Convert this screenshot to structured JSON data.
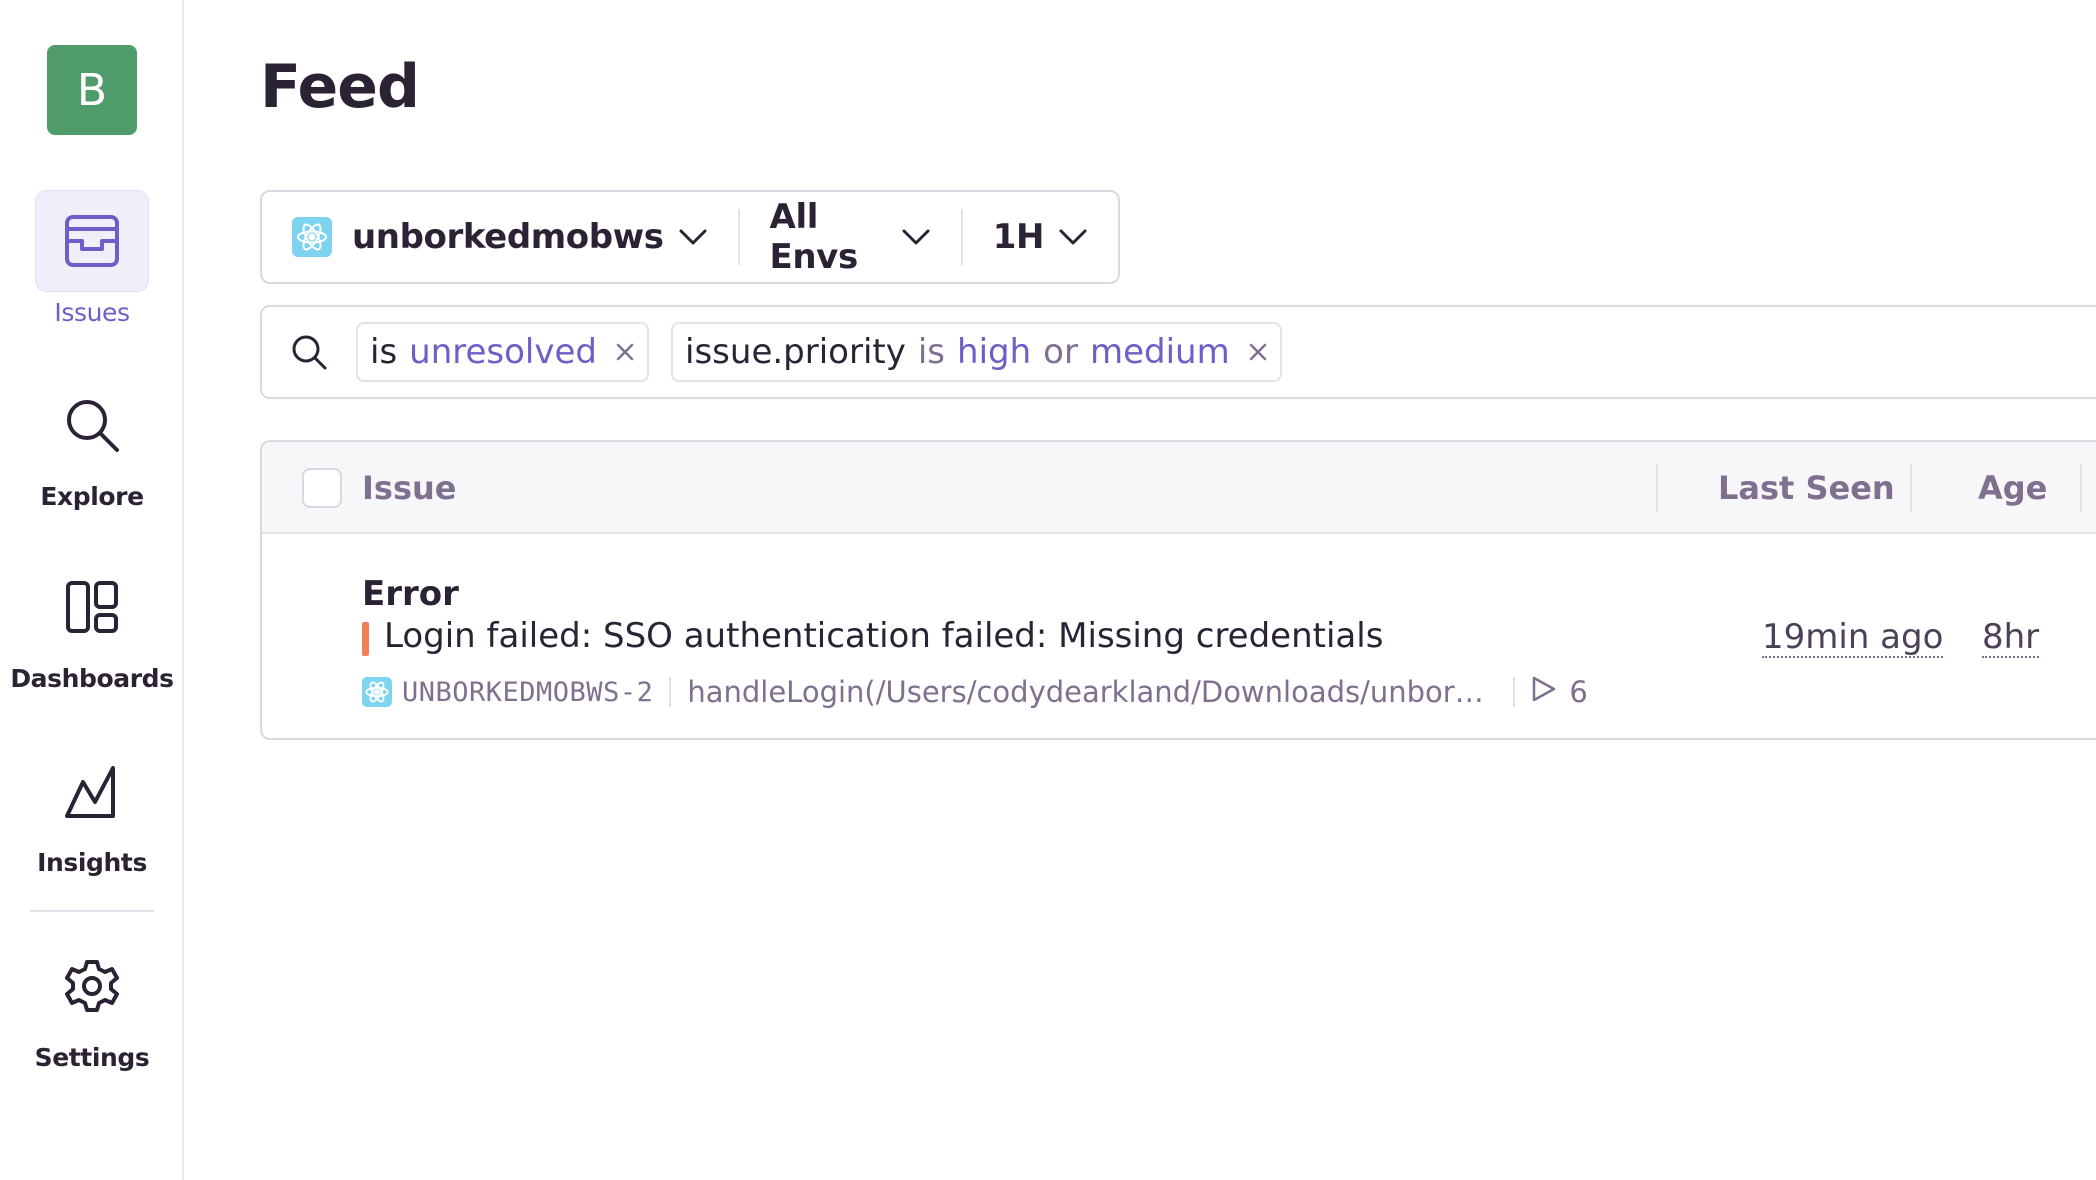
{
  "sidebar": {
    "org_initial": "B",
    "org_color": "#4f9c6a",
    "items": [
      {
        "label": "Issues",
        "icon": "issues-inbox-icon",
        "active": true
      },
      {
        "label": "Explore",
        "icon": "search-icon",
        "active": false
      },
      {
        "label": "Dashboards",
        "icon": "dashboards-icon",
        "active": false
      },
      {
        "label": "Insights",
        "icon": "insights-graph-icon",
        "active": false
      },
      {
        "label": "Settings",
        "icon": "gear-icon",
        "active": false
      }
    ]
  },
  "page": {
    "title": "Feed"
  },
  "filters": {
    "project": "unborkedmobws",
    "project_icon": "react-icon",
    "environment": "All Envs",
    "time_range": "1H"
  },
  "search": {
    "tokens": [
      {
        "key": "",
        "op": "is",
        "values": [
          "unresolved"
        ],
        "joiner": ""
      },
      {
        "key": "issue.priority",
        "op": "is",
        "values": [
          "high",
          "medium"
        ],
        "joiner": "or"
      }
    ]
  },
  "table": {
    "headers": {
      "issue": "Issue",
      "last_seen": "Last Seen",
      "age": "Age"
    },
    "rows": [
      {
        "type": "Error",
        "message": "Login failed: SSO authentication failed: Missing credentials",
        "priority_color": "#f0805a",
        "short_id": "UNBORKEDMOBWS-2",
        "culprit": "handleLogin(/Users/codydearkland/Downloads/unborke…",
        "replays": "6",
        "last_seen": "19min ago",
        "age": "8hr"
      }
    ]
  },
  "colors": {
    "accent": "#6c5fc7",
    "text": "#2b2233",
    "muted": "#80708f",
    "border": "#dcd7e2"
  }
}
